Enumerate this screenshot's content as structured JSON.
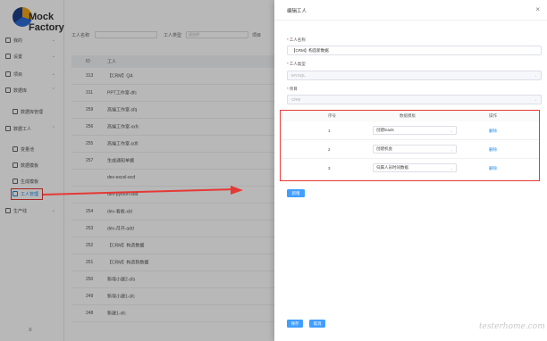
{
  "app": {
    "logo_text": "Mock Factory"
  },
  "sidebar": {
    "items": [
      {
        "label": "我的"
      },
      {
        "label": "设置"
      },
      {
        "label": "项目"
      },
      {
        "label": "数据库"
      },
      {
        "label": "数据库管理"
      },
      {
        "label": "数据工人"
      },
      {
        "label": "变量池"
      },
      {
        "label": "数据模板"
      },
      {
        "label": "生成模板"
      },
      {
        "label": "工人管理"
      },
      {
        "label": "生产线"
      }
    ],
    "footer": "≡"
  },
  "filters": {
    "worker_name_label": "工人名称",
    "worker_type_label": "工人类型",
    "worker_type_placeholder": "请选择",
    "project_label": "项目"
  },
  "background_table": {
    "headers": [
      "ID",
      "工人"
    ],
    "rows": [
      {
        "id": "313",
        "name": "【CRM】QA"
      },
      {
        "id": "311",
        "name": "PPT工作室-dfc"
      },
      {
        "id": "259",
        "name": "高端工作室-sfq"
      },
      {
        "id": "256",
        "name": "高端工作室-xxfc"
      },
      {
        "id": "255",
        "name": "高端工作室-sdfi"
      },
      {
        "id": "257",
        "name": "生成通知单据"
      },
      {
        "id": "",
        "name": "dev-excel-ecd"
      },
      {
        "id": "",
        "name": "dev-python-sdd"
      },
      {
        "id": "254",
        "name": "dev-看板-xld"
      },
      {
        "id": "253",
        "name": "dev-月开-add"
      },
      {
        "id": "252",
        "name": "【CRM】构造数据"
      },
      {
        "id": "251",
        "name": "【CRM】构造新数据"
      },
      {
        "id": "250",
        "name": "新增小建2-sfa"
      },
      {
        "id": "249",
        "name": "新增小建1-sfc"
      },
      {
        "id": "248",
        "name": "新建1-xfc"
      }
    ]
  },
  "drawer": {
    "title": "编辑工人",
    "close": "×",
    "name_label": "工人名称",
    "name_value": "【CRM】构造新数据",
    "type_label": "工人类型",
    "type_value": "MYSQL",
    "project_label": "项目",
    "project_value": "CRM",
    "items_table": {
      "headers": {
        "seq": "序号",
        "template": "数据模板",
        "op": "操作"
      },
      "rows": [
        {
          "seq": "1",
          "template": "创建leads",
          "op": "删除"
        },
        {
          "seq": "2",
          "template": "创建机会",
          "op": "删除"
        },
        {
          "seq": "3",
          "template": "归属人员时间数据",
          "op": "删除"
        }
      ]
    },
    "add_button": "新增",
    "save_button": "保存",
    "cancel_button": "取消"
  },
  "watermark": "testerhome.com",
  "colors": {
    "primary": "#409eff",
    "highlight": "#e53935"
  }
}
